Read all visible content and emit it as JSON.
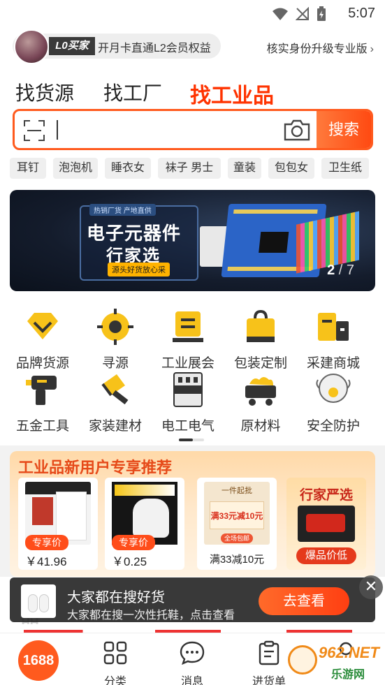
{
  "status_bar": {
    "time": "5:07"
  },
  "header": {
    "member_badge": "L0买家",
    "member_text": "开月卡直通L2会员权益",
    "verify_link": "核实身份升级专业版"
  },
  "tabs": [
    {
      "label": "找货源"
    },
    {
      "label": "找工厂"
    },
    {
      "label": "找工业品"
    }
  ],
  "search": {
    "button_label": "搜索",
    "value": ""
  },
  "hot_words": [
    "耳钉",
    "泡泡机",
    "睡衣女",
    "袜子 男士",
    "童装",
    "包包女",
    "卫生纸"
  ],
  "banner": {
    "tag": "热销厂货 产地直供",
    "title_line1": "电子元器件",
    "title_line2": "行家选",
    "subtitle": "源头好货放心采",
    "current": "2",
    "total": "/ 7"
  },
  "categories": [
    {
      "label": "品牌货源",
      "icon": "brand-diamond-icon"
    },
    {
      "label": "寻源",
      "icon": "target-icon"
    },
    {
      "label": "工业展会",
      "icon": "exhibition-icon"
    },
    {
      "label": "包装定制",
      "icon": "bag-icon"
    },
    {
      "label": "采建商城",
      "icon": "mall-icon"
    },
    {
      "label": "五金工具",
      "icon": "drill-icon"
    },
    {
      "label": "家装建材",
      "icon": "brush-icon"
    },
    {
      "label": "电工电气",
      "icon": "breaker-icon"
    },
    {
      "label": "原材料",
      "icon": "ore-cart-icon"
    },
    {
      "label": "安全防护",
      "icon": "mask-icon"
    }
  ],
  "promo": {
    "title": "工业品新用户专享推荐",
    "products": [
      {
        "tag": "专享价",
        "price": "￥41.96"
      },
      {
        "tag": "专享价",
        "price": "￥0.25"
      },
      {
        "coupon_top": "一件起批",
        "coupon_mid": "满33元减10元",
        "coupon_btn": "全场包邮",
        "desc": "满33减10元"
      },
      {
        "title": "行家严选",
        "button": "爆品价低"
      }
    ]
  },
  "behind_text": "品",
  "floating_bar": {
    "title": "大家都在搜好货",
    "subtitle": "大家都在搜一次性托鞋，点击查看",
    "button": "去查看",
    "close": "✕"
  },
  "tab_bar": [
    {
      "label": "1688"
    },
    {
      "label": "分类"
    },
    {
      "label": "消息"
    },
    {
      "label": "进货单"
    }
  ],
  "watermark": {
    "text": "962.NET",
    "sub": "乐游网"
  },
  "colors": {
    "accent": "#ff5a1e",
    "active_tab": "#ff3300"
  }
}
